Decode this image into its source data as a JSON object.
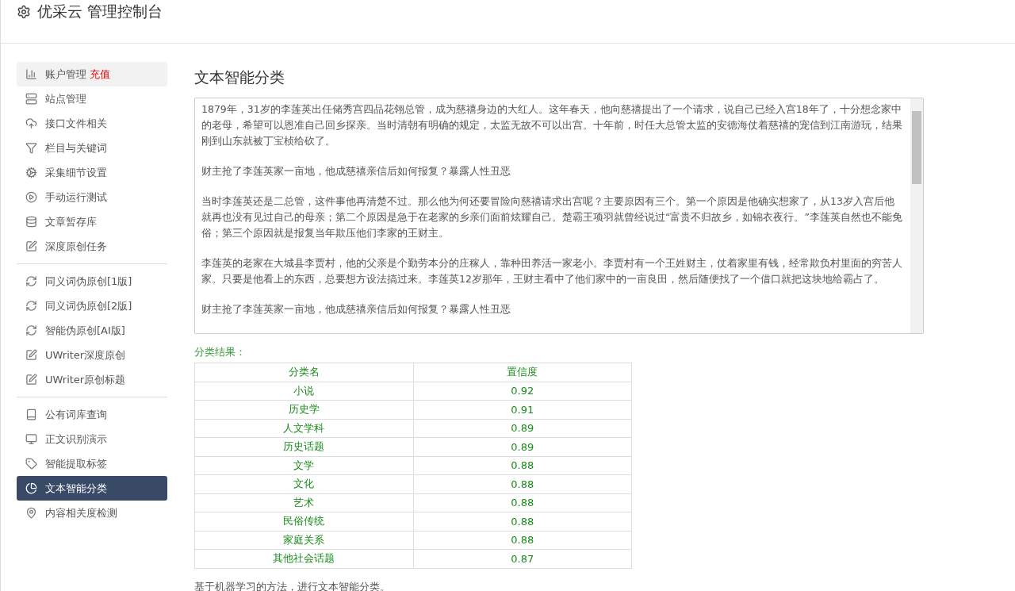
{
  "header": {
    "title": "优采云 管理控制台"
  },
  "sidebar": {
    "groups": [
      {
        "items": [
          {
            "label": "账户管理",
            "badge": "充值",
            "selected": false,
            "hover": true
          },
          {
            "label": "站点管理",
            "selected": false,
            "hover": false
          },
          {
            "label": "接口文件相关",
            "selected": false,
            "hover": false
          },
          {
            "label": "栏目与关键词",
            "selected": false,
            "hover": false
          },
          {
            "label": "采集细节设置",
            "selected": false,
            "hover": false
          },
          {
            "label": "手动运行测试",
            "selected": false,
            "hover": false
          },
          {
            "label": "文章暂存库",
            "selected": false,
            "hover": false
          },
          {
            "label": "深度原创任务",
            "selected": false,
            "hover": false
          }
        ]
      },
      {
        "items": [
          {
            "label": "同义词伪原创[1版]",
            "selected": false,
            "hover": false
          },
          {
            "label": "同义词伪原创[2版]",
            "selected": false,
            "hover": false
          },
          {
            "label": "智能伪原创[AI版]",
            "selected": false,
            "hover": false
          },
          {
            "label": "UWriter深度原创",
            "selected": false,
            "hover": false
          },
          {
            "label": "UWriter原创标题",
            "selected": false,
            "hover": false
          }
        ]
      },
      {
        "items": [
          {
            "label": "公有词库查询",
            "selected": false,
            "hover": false
          },
          {
            "label": "正文识别演示",
            "selected": false,
            "hover": false
          },
          {
            "label": "智能提取标签",
            "selected": false,
            "hover": false
          },
          {
            "label": "文本智能分类",
            "selected": true,
            "hover": false
          },
          {
            "label": "内容相关度检测",
            "selected": false,
            "hover": false
          }
        ]
      }
    ]
  },
  "main": {
    "title": "文本智能分类",
    "article": [
      "1879年，31岁的李莲英出任储秀宫四品花翎总管，成为慈禧身边的大红人。这年春天，他向慈禧提出了一个请求，说自己已经入宫18年了，十分想念家中的老母，希望可以恩准自己回乡探亲。当时清朝有明确的规定，太监无故不可以出宫。十年前，时任大总管太监的安德海仗着慈禧的宠信到江南游玩，结果刚到山东就被丁宝桢给砍了。",
      "财主抢了李莲英家一亩地，他成慈禧亲信后如何报复？暴露人性丑恶",
      "当时李莲英还是二总管，这件事他再清楚不过。那么他为何还要冒险向慈禧请求出宫呢？主要原因有三个。第一个原因是他确实想家了，从13岁入宫后他就再也没有见过自己的母亲；第二个原因是急于在老家的乡亲们面前炫耀自己。楚霸王项羽就曾经说过“富贵不归故乡，如锦衣夜行。”李莲英自然也不能免俗；第三个原因就是报复当年欺压他们李家的王财主。",
      "李莲英的老家在大城县李贾村，他的父亲是个勤劳本分的庄稼人，靠种田养活一家老小。李贾村有一个王姓财主，仗着家里有钱，经常欺负村里面的穷苦人家。只要是他看上的东西，总要想方设法搞过来。李莲英12岁那年，王财主看中了他们家中的一亩良田，然后随便找了一个借口就把这块地给霸占了。",
      "财主抢了李莲英家一亩地，他成慈禧亲信后如何报复？暴露人性丑恶"
    ],
    "result_label": "分类结果：",
    "table": {
      "columns": [
        "分类名",
        "置信度"
      ],
      "rows": [
        [
          "小说",
          "0.92"
        ],
        [
          "历史学",
          "0.91"
        ],
        [
          "人文学科",
          "0.89"
        ],
        [
          "历史话题",
          "0.89"
        ],
        [
          "文学",
          "0.88"
        ],
        [
          "文化",
          "0.88"
        ],
        [
          "艺术",
          "0.88"
        ],
        [
          "民俗传统",
          "0.88"
        ],
        [
          "家庭关系",
          "0.88"
        ],
        [
          "其他社会话题",
          "0.87"
        ]
      ]
    },
    "note": "基于机器学习的方法，进行文本智能分类。"
  }
}
